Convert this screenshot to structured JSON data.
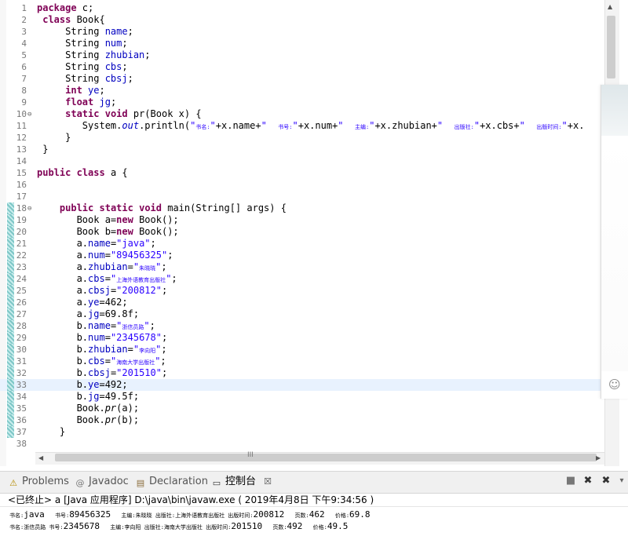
{
  "editor": {
    "lines": [
      {
        "n": "1",
        "segs": [
          {
            "t": "package",
            "c": "kw"
          },
          {
            "t": " c;"
          }
        ]
      },
      {
        "n": "2",
        "segs": [
          {
            "t": " "
          },
          {
            "t": "class",
            "c": "kw"
          },
          {
            "t": " Book{"
          }
        ]
      },
      {
        "n": "3",
        "segs": [
          {
            "t": "     String "
          },
          {
            "t": "name",
            "c": "fld"
          },
          {
            "t": ";"
          }
        ]
      },
      {
        "n": "4",
        "segs": [
          {
            "t": "     String "
          },
          {
            "t": "num",
            "c": "fld"
          },
          {
            "t": ";"
          }
        ]
      },
      {
        "n": "5",
        "segs": [
          {
            "t": "     String "
          },
          {
            "t": "zhubian",
            "c": "fld"
          },
          {
            "t": ";"
          }
        ]
      },
      {
        "n": "6",
        "segs": [
          {
            "t": "     String "
          },
          {
            "t": "cbs",
            "c": "fld"
          },
          {
            "t": ";"
          }
        ]
      },
      {
        "n": "7",
        "segs": [
          {
            "t": "     String "
          },
          {
            "t": "cbsj",
            "c": "fld"
          },
          {
            "t": ";"
          }
        ]
      },
      {
        "n": "8",
        "segs": [
          {
            "t": "     "
          },
          {
            "t": "int",
            "c": "kw"
          },
          {
            "t": " "
          },
          {
            "t": "ye",
            "c": "fld"
          },
          {
            "t": ";"
          }
        ]
      },
      {
        "n": "9",
        "segs": [
          {
            "t": "     "
          },
          {
            "t": "float",
            "c": "kw"
          },
          {
            "t": " "
          },
          {
            "t": "jg",
            "c": "fld"
          },
          {
            "t": ";"
          }
        ]
      },
      {
        "n": "10",
        "fold": true,
        "segs": [
          {
            "t": "     "
          },
          {
            "t": "static",
            "c": "kw"
          },
          {
            "t": " "
          },
          {
            "t": "void",
            "c": "kw"
          },
          {
            "t": " pr(Book x) {"
          }
        ]
      },
      {
        "n": "11",
        "segs": [
          {
            "t": "        System."
          },
          {
            "t": "out",
            "c": "fld st"
          },
          {
            "t": ".println("
          },
          {
            "t": "\"",
            "c": "str"
          },
          {
            "t": "书名:",
            "c": "str cjk"
          },
          {
            "t": "\"",
            "c": "str"
          },
          {
            "t": "+x.name+"
          },
          {
            "t": "\"  ",
            "c": "str"
          },
          {
            "t": "书号:",
            "c": "str cjk"
          },
          {
            "t": "\"",
            "c": "str"
          },
          {
            "t": "+x.num+"
          },
          {
            "t": "\"  ",
            "c": "str"
          },
          {
            "t": "主编:",
            "c": "str cjk"
          },
          {
            "t": "\"",
            "c": "str"
          },
          {
            "t": "+x.zhubian+"
          },
          {
            "t": "\"  ",
            "c": "str"
          },
          {
            "t": "出版社:",
            "c": "str cjk"
          },
          {
            "t": "\"",
            "c": "str"
          },
          {
            "t": "+x.cbs+"
          },
          {
            "t": "\"  ",
            "c": "str"
          },
          {
            "t": "出版时间:",
            "c": "str cjk"
          },
          {
            "t": "\"",
            "c": "str"
          },
          {
            "t": "+x."
          }
        ]
      },
      {
        "n": "12",
        "segs": [
          {
            "t": "     }"
          }
        ]
      },
      {
        "n": "13",
        "segs": [
          {
            "t": " }"
          }
        ]
      },
      {
        "n": "14",
        "segs": []
      },
      {
        "n": "15",
        "segs": [
          {
            "t": "public",
            "c": "kw"
          },
          {
            "t": " "
          },
          {
            "t": "class",
            "c": "kw"
          },
          {
            "t": " a {"
          }
        ]
      },
      {
        "n": "16",
        "segs": []
      },
      {
        "n": "17",
        "segs": []
      },
      {
        "n": "18",
        "fold": true,
        "mark": true,
        "segs": [
          {
            "t": "    "
          },
          {
            "t": "public",
            "c": "kw"
          },
          {
            "t": " "
          },
          {
            "t": "static",
            "c": "kw"
          },
          {
            "t": " "
          },
          {
            "t": "void",
            "c": "kw"
          },
          {
            "t": " main(String[] args) {"
          }
        ]
      },
      {
        "n": "19",
        "mark": true,
        "segs": [
          {
            "t": "       Book a="
          },
          {
            "t": "new",
            "c": "kw"
          },
          {
            "t": " Book();"
          }
        ]
      },
      {
        "n": "20",
        "mark": true,
        "segs": [
          {
            "t": "       Book b="
          },
          {
            "t": "new",
            "c": "kw"
          },
          {
            "t": " Book();"
          }
        ]
      },
      {
        "n": "21",
        "mark": true,
        "segs": [
          {
            "t": "       a."
          },
          {
            "t": "name",
            "c": "fld"
          },
          {
            "t": "="
          },
          {
            "t": "\"java\"",
            "c": "str"
          },
          {
            "t": ";"
          }
        ]
      },
      {
        "n": "22",
        "mark": true,
        "segs": [
          {
            "t": "       a."
          },
          {
            "t": "num",
            "c": "fld"
          },
          {
            "t": "="
          },
          {
            "t": "\"89456325\"",
            "c": "str"
          },
          {
            "t": ";"
          }
        ]
      },
      {
        "n": "23",
        "mark": true,
        "segs": [
          {
            "t": "       a."
          },
          {
            "t": "zhubian",
            "c": "fld"
          },
          {
            "t": "="
          },
          {
            "t": "\"",
            "c": "str"
          },
          {
            "t": "朱晓晓",
            "c": "str cjk"
          },
          {
            "t": "\"",
            "c": "str"
          },
          {
            "t": ";"
          }
        ]
      },
      {
        "n": "24",
        "mark": true,
        "segs": [
          {
            "t": "       a."
          },
          {
            "t": "cbs",
            "c": "fld"
          },
          {
            "t": "="
          },
          {
            "t": "\"",
            "c": "str"
          },
          {
            "t": "上海外语教育出版社",
            "c": "str cjk"
          },
          {
            "t": "\"",
            "c": "str"
          },
          {
            "t": ";"
          }
        ]
      },
      {
        "n": "25",
        "mark": true,
        "segs": [
          {
            "t": "       a."
          },
          {
            "t": "cbsj",
            "c": "fld"
          },
          {
            "t": "="
          },
          {
            "t": "\"200812\"",
            "c": "str"
          },
          {
            "t": ";"
          }
        ]
      },
      {
        "n": "26",
        "mark": true,
        "segs": [
          {
            "t": "       a."
          },
          {
            "t": "ye",
            "c": "fld"
          },
          {
            "t": "=462;"
          }
        ]
      },
      {
        "n": "27",
        "mark": true,
        "segs": [
          {
            "t": "       a."
          },
          {
            "t": "jg",
            "c": "fld"
          },
          {
            "t": "=69.8f;"
          }
        ]
      },
      {
        "n": "28",
        "mark": true,
        "segs": [
          {
            "t": "       b."
          },
          {
            "t": "name",
            "c": "fld"
          },
          {
            "t": "="
          },
          {
            "t": "\"",
            "c": "str"
          },
          {
            "t": "浙信员路",
            "c": "str cjk"
          },
          {
            "t": "\"",
            "c": "str"
          },
          {
            "t": ";"
          }
        ]
      },
      {
        "n": "29",
        "mark": true,
        "segs": [
          {
            "t": "       b."
          },
          {
            "t": "num",
            "c": "fld"
          },
          {
            "t": "="
          },
          {
            "t": "\"2345678\"",
            "c": "str"
          },
          {
            "t": ";"
          }
        ]
      },
      {
        "n": "30",
        "mark": true,
        "segs": [
          {
            "t": "       b."
          },
          {
            "t": "zhubian",
            "c": "fld"
          },
          {
            "t": "="
          },
          {
            "t": "\"",
            "c": "str"
          },
          {
            "t": "李向阳",
            "c": "str cjk"
          },
          {
            "t": "\"",
            "c": "str"
          },
          {
            "t": ";"
          }
        ]
      },
      {
        "n": "31",
        "mark": true,
        "segs": [
          {
            "t": "       b."
          },
          {
            "t": "cbs",
            "c": "fld"
          },
          {
            "t": "="
          },
          {
            "t": "\"",
            "c": "str"
          },
          {
            "t": "海南大学出版社",
            "c": "str cjk"
          },
          {
            "t": "\"",
            "c": "str"
          },
          {
            "t": ";"
          }
        ]
      },
      {
        "n": "32",
        "mark": true,
        "segs": [
          {
            "t": "       b."
          },
          {
            "t": "cbsj",
            "c": "fld"
          },
          {
            "t": "="
          },
          {
            "t": "\"201510\"",
            "c": "str"
          },
          {
            "t": ";"
          }
        ]
      },
      {
        "n": "33",
        "mark": true,
        "hl": true,
        "segs": [
          {
            "t": "       b."
          },
          {
            "t": "ye",
            "c": "fld"
          },
          {
            "t": "=492;"
          }
        ]
      },
      {
        "n": "34",
        "mark": true,
        "segs": [
          {
            "t": "       b."
          },
          {
            "t": "jg",
            "c": "fld"
          },
          {
            "t": "=49.5f;"
          }
        ]
      },
      {
        "n": "35",
        "mark": true,
        "segs": [
          {
            "t": "       Book."
          },
          {
            "t": "pr",
            "c": "st"
          },
          {
            "t": "(a);"
          }
        ]
      },
      {
        "n": "36",
        "mark": true,
        "segs": [
          {
            "t": "       Book."
          },
          {
            "t": "pr",
            "c": "st"
          },
          {
            "t": "(b);"
          }
        ]
      },
      {
        "n": "37",
        "mark": true,
        "segs": [
          {
            "t": "    }"
          }
        ]
      },
      {
        "n": "38",
        "segs": []
      }
    ],
    "fold_glyph": "⊖",
    "hscroll_glyph": "III"
  },
  "tabs": [
    {
      "label": "Problems",
      "icon": "⚠",
      "icon_name": "problems-icon",
      "active": false
    },
    {
      "label": "Javadoc",
      "icon": "@",
      "icon_name": "javadoc-icon",
      "active": false
    },
    {
      "label": "Declaration",
      "icon": "▤",
      "icon_name": "declaration-icon",
      "active": false
    },
    {
      "label": "控制台",
      "icon": "▭",
      "icon_name": "console-icon",
      "active": true
    }
  ],
  "tab_close": "☒",
  "view_icons": [
    {
      "name": "terminate-icon",
      "glyph": "■"
    },
    {
      "name": "remove-launch-icon",
      "glyph": "✖"
    },
    {
      "name": "remove-all-icon",
      "glyph": "✖"
    }
  ],
  "status": "<已终止> a [Java 应用程序] D:\\java\\bin\\javaw.exe ( 2019年4月8日 下午9:34:56 )",
  "console": [
    [
      {
        "t": "书名:",
        "c": "c"
      },
      {
        "t": "java  "
      },
      {
        "t": "书号:",
        "c": "c"
      },
      {
        "t": "89456325  "
      },
      {
        "t": "主编:朱晓晓 出版社:上海外语教育出版社 出版时间:",
        "c": "c"
      },
      {
        "t": "200812  "
      },
      {
        "t": "页数:",
        "c": "c"
      },
      {
        "t": "462  "
      },
      {
        "t": "价格:",
        "c": "c"
      },
      {
        "t": "69.8"
      }
    ],
    [
      {
        "t": "书名:浙信员路 书号:",
        "c": "c"
      },
      {
        "t": "2345678  "
      },
      {
        "t": "主编:李向阳 出版社:海南大学出版社 出版时间:",
        "c": "c"
      },
      {
        "t": "201510  "
      },
      {
        "t": "页数:",
        "c": "c"
      },
      {
        "t": "492  "
      },
      {
        "t": "价格:",
        "c": "c"
      },
      {
        "t": "49.5"
      }
    ]
  ],
  "smiley": "☺"
}
